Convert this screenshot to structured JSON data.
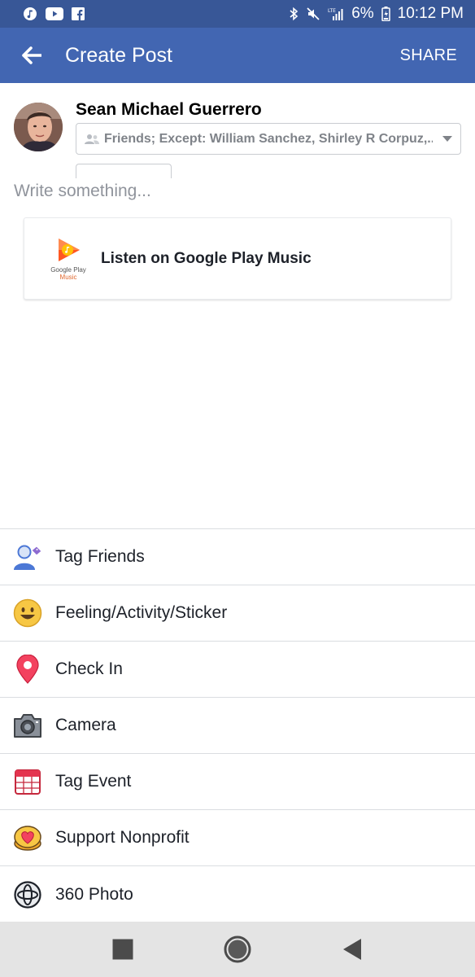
{
  "status_bar": {
    "battery": "6%",
    "time": "10:12 PM",
    "icons": [
      "music-icon",
      "youtube-icon",
      "facebook-icon",
      "bluetooth-icon",
      "mute-icon",
      "lte-signal-icon",
      "battery-icon"
    ]
  },
  "app_bar": {
    "title": "Create Post",
    "share_label": "SHARE"
  },
  "composer": {
    "user_name": "Sean Michael Guerrero",
    "audience": "Friends; Except: William Sanchez, Shirley R Corpuz,...",
    "placeholder": "Write something..."
  },
  "attachment": {
    "title": "Listen on Google Play Music",
    "logo_caption_1": "Google Play",
    "logo_caption_2": "Music"
  },
  "options": [
    {
      "label": "Tag Friends",
      "icon": "tag-friends-icon"
    },
    {
      "label": "Feeling/Activity/Sticker",
      "icon": "feeling-icon"
    },
    {
      "label": "Check In",
      "icon": "location-pin-icon"
    },
    {
      "label": "Camera",
      "icon": "camera-icon"
    },
    {
      "label": "Tag Event",
      "icon": "calendar-icon"
    },
    {
      "label": "Support Nonprofit",
      "icon": "nonprofit-heart-icon"
    },
    {
      "label": "360 Photo",
      "icon": "360-photo-icon"
    }
  ],
  "colors": {
    "status_bar": "#385797",
    "app_bar": "#4266b2",
    "nav_bar": "#e4e4e4"
  }
}
